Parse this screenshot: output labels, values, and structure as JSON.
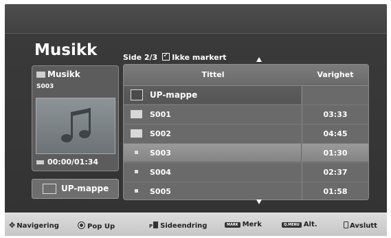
{
  "header": {
    "title": "Musikk",
    "page_info": "Side 2/3",
    "mark_status": "Ikke markert"
  },
  "side_panel": {
    "folder_label": "Musikk",
    "code": "S003",
    "time": "00:00/01:34",
    "up_button": "UP-mappe",
    "icons": [
      "folder-icon",
      "music-note-icon",
      "progress-bar-icon",
      "up-folder-icon"
    ]
  },
  "list": {
    "columns": {
      "title": "Tittel",
      "duration": "Varighet"
    },
    "rows": [
      {
        "name": "UP-mappe",
        "duration": "",
        "type": "up",
        "selected": false
      },
      {
        "name": "S001",
        "duration": "03:33",
        "type": "folder",
        "selected": false
      },
      {
        "name": "S002",
        "duration": "04:45",
        "type": "folder",
        "selected": false
      },
      {
        "name": "S003",
        "duration": "01:30",
        "type": "file",
        "selected": true
      },
      {
        "name": "S004",
        "duration": "02:37",
        "type": "file",
        "selected": false
      },
      {
        "name": "S005",
        "duration": "01:58",
        "type": "file",
        "selected": false
      }
    ]
  },
  "footer": {
    "navigate": "Navigering",
    "popup": "Pop Up",
    "page_change_prefix": "P",
    "page_change": "Sideendring",
    "mark_badge": "MARK",
    "mark": "Merk",
    "menu_badge": "Q.MENU",
    "options": "Alt.",
    "exit": "Avslutt"
  },
  "colors": {
    "background": "#3a3a3a",
    "selection": "#8e8e8e",
    "footer": "#d0d0d0"
  }
}
